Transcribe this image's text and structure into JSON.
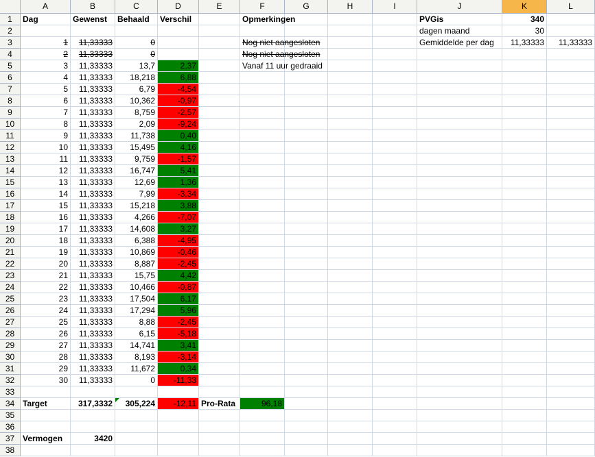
{
  "columns": [
    "A",
    "B",
    "C",
    "D",
    "E",
    "F",
    "G",
    "H",
    "I",
    "J",
    "K",
    "L"
  ],
  "selected_column": "K",
  "row_numbers": [
    "1",
    "2",
    "3",
    "4",
    "5",
    "6",
    "7",
    "8",
    "9",
    "10",
    "11",
    "12",
    "13",
    "14",
    "15",
    "16",
    "17",
    "18",
    "19",
    "20",
    "21",
    "22",
    "23",
    "24",
    "25",
    "26",
    "27",
    "28",
    "29",
    "30",
    "31",
    "32",
    "33",
    "34",
    "35",
    "36",
    "37",
    "38"
  ],
  "headers": {
    "dag": "Dag",
    "gewenst": "Gewenst",
    "behaald": "Behaald",
    "verschil": "Verschil",
    "opmerkingen": "Opmerkingen"
  },
  "days": [
    {
      "dag": "1",
      "gewenst": "11,33333",
      "behaald": "0",
      "verschil": "",
      "fill": "none",
      "strike": true
    },
    {
      "dag": "2",
      "gewenst": "11,33333",
      "behaald": "0",
      "verschil": "",
      "fill": "none",
      "strike": true
    },
    {
      "dag": "3",
      "gewenst": "11,33333",
      "behaald": "13,7",
      "verschil": "2,37",
      "fill": "green"
    },
    {
      "dag": "4",
      "gewenst": "11,33333",
      "behaald": "18,218",
      "verschil": "6,88",
      "fill": "green"
    },
    {
      "dag": "5",
      "gewenst": "11,33333",
      "behaald": "6,79",
      "verschil": "-4,54",
      "fill": "red"
    },
    {
      "dag": "6",
      "gewenst": "11,33333",
      "behaald": "10,362",
      "verschil": "-0,97",
      "fill": "red"
    },
    {
      "dag": "7",
      "gewenst": "11,33333",
      "behaald": "8,759",
      "verschil": "-2,57",
      "fill": "red"
    },
    {
      "dag": "8",
      "gewenst": "11,33333",
      "behaald": "2,09",
      "verschil": "-9,24",
      "fill": "red"
    },
    {
      "dag": "9",
      "gewenst": "11,33333",
      "behaald": "11,738",
      "verschil": "0,40",
      "fill": "green"
    },
    {
      "dag": "10",
      "gewenst": "11,33333",
      "behaald": "15,495",
      "verschil": "4,16",
      "fill": "green"
    },
    {
      "dag": "11",
      "gewenst": "11,33333",
      "behaald": "9,759",
      "verschil": "-1,57",
      "fill": "red"
    },
    {
      "dag": "12",
      "gewenst": "11,33333",
      "behaald": "16,747",
      "verschil": "5,41",
      "fill": "green"
    },
    {
      "dag": "13",
      "gewenst": "11,33333",
      "behaald": "12,69",
      "verschil": "1,36",
      "fill": "green"
    },
    {
      "dag": "14",
      "gewenst": "11,33333",
      "behaald": "7,99",
      "verschil": "-3,34",
      "fill": "red"
    },
    {
      "dag": "15",
      "gewenst": "11,33333",
      "behaald": "15,218",
      "verschil": "3,88",
      "fill": "green"
    },
    {
      "dag": "16",
      "gewenst": "11,33333",
      "behaald": "4,266",
      "verschil": "-7,07",
      "fill": "red"
    },
    {
      "dag": "17",
      "gewenst": "11,33333",
      "behaald": "14,608",
      "verschil": "3,27",
      "fill": "green"
    },
    {
      "dag": "18",
      "gewenst": "11,33333",
      "behaald": "6,388",
      "verschil": "-4,95",
      "fill": "red"
    },
    {
      "dag": "19",
      "gewenst": "11,33333",
      "behaald": "10,869",
      "verschil": "-0,46",
      "fill": "red"
    },
    {
      "dag": "20",
      "gewenst": "11,33333",
      "behaald": "8,887",
      "verschil": "-2,45",
      "fill": "red"
    },
    {
      "dag": "21",
      "gewenst": "11,33333",
      "behaald": "15,75",
      "verschil": "4,42",
      "fill": "green"
    },
    {
      "dag": "22",
      "gewenst": "11,33333",
      "behaald": "10,466",
      "verschil": "-0,87",
      "fill": "red"
    },
    {
      "dag": "23",
      "gewenst": "11,33333",
      "behaald": "17,504",
      "verschil": "6,17",
      "fill": "green"
    },
    {
      "dag": "24",
      "gewenst": "11,33333",
      "behaald": "17,294",
      "verschil": "5,96",
      "fill": "green"
    },
    {
      "dag": "25",
      "gewenst": "11,33333",
      "behaald": "8,88",
      "verschil": "-2,45",
      "fill": "red"
    },
    {
      "dag": "26",
      "gewenst": "11,33333",
      "behaald": "6,15",
      "verschil": "-5,18",
      "fill": "red"
    },
    {
      "dag": "27",
      "gewenst": "11,33333",
      "behaald": "14,741",
      "verschil": "3,41",
      "fill": "green"
    },
    {
      "dag": "28",
      "gewenst": "11,33333",
      "behaald": "8,193",
      "verschil": "-3,14",
      "fill": "red"
    },
    {
      "dag": "29",
      "gewenst": "11,33333",
      "behaald": "11,672",
      "verschil": "0,34",
      "fill": "green"
    },
    {
      "dag": "30",
      "gewenst": "11,33333",
      "behaald": "0",
      "verschil": "-11,33",
      "fill": "red"
    }
  ],
  "remarks": [
    {
      "text": "Nog niet aangesloten",
      "strike": true
    },
    {
      "text": "Nog niet aangesloten",
      "strike": true
    },
    {
      "text": "Vanaf 11 uur gedraaid",
      "strike": false
    }
  ],
  "totals": {
    "label": "Target",
    "gewenst": "317,3332",
    "behaald": "305,224",
    "verschil": "-12,11",
    "prorata_label": "Pro-Rata",
    "prorata_value": "96,18"
  },
  "vermogen": {
    "label": "Vermogen",
    "value": "3420"
  },
  "pvgis": {
    "label": "PVGis",
    "value": "340",
    "dagen_label": "dagen maand",
    "dagen_value": "30",
    "gem_label": "Gemiddelde per dag",
    "gem_value_k": "11,33333",
    "gem_value_l": "11,33333"
  },
  "colors": {
    "positive": "#008000",
    "negative": "#ff0000",
    "selected_header": "#f7b64a"
  }
}
